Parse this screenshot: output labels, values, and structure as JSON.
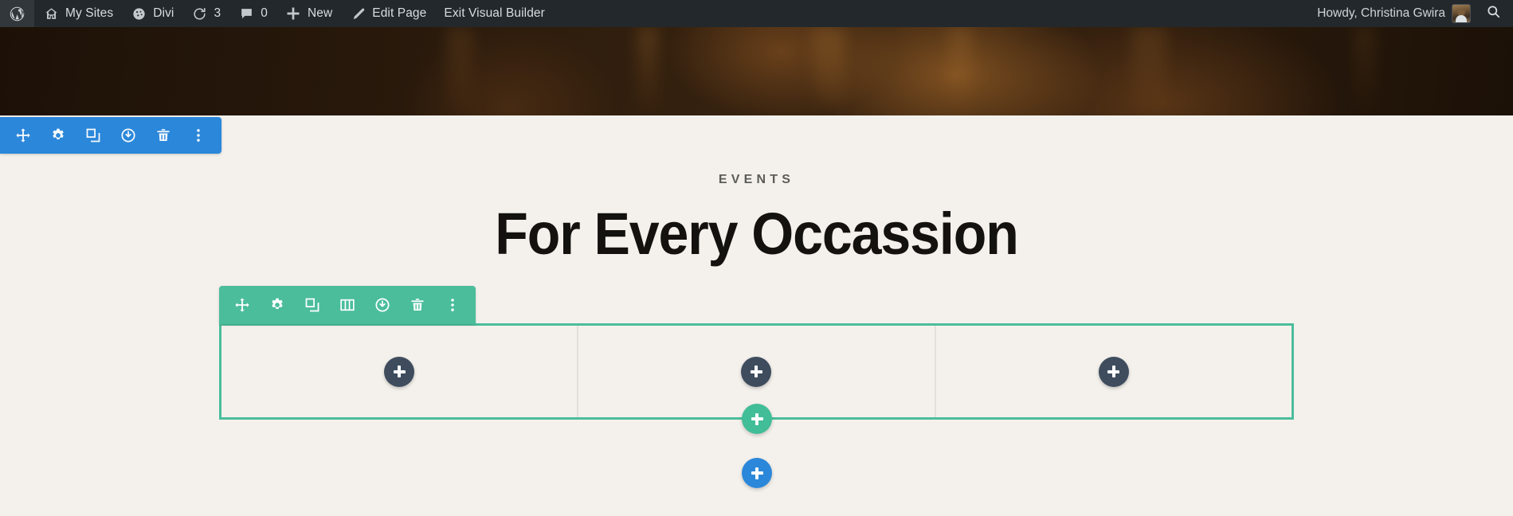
{
  "admin_bar": {
    "left_items": [
      {
        "icon": "wordpress-logo-icon",
        "label": ""
      },
      {
        "icon": "my-sites-icon",
        "label": "My Sites"
      },
      {
        "icon": "divi-icon",
        "label": "Divi"
      },
      {
        "icon": "updates-icon",
        "label": "3"
      },
      {
        "icon": "comments-icon",
        "label": "0"
      },
      {
        "icon": "new-content-icon",
        "label": "New"
      },
      {
        "icon": "edit-page-icon",
        "label": "Edit Page"
      },
      {
        "icon": "",
        "label": "Exit Visual Builder"
      }
    ],
    "howdy": "Howdy, Christina Gwira",
    "avatar_alt": "avatar",
    "search_icon": "search-icon",
    "background": "#23282d",
    "text_color": "#d8dde1"
  },
  "page": {
    "eyebrow": "EVENTS",
    "title": "For Every Occassion",
    "background": "#f4f1ec"
  },
  "section_toolbar": {
    "color": "#2b87da",
    "buttons": [
      {
        "name": "move-section-icon",
        "title": "Move Section"
      },
      {
        "name": "settings-gear-icon",
        "title": "Section Settings"
      },
      {
        "name": "duplicate-section-icon",
        "title": "Duplicate Section"
      },
      {
        "name": "disable-section-icon",
        "title": "Disable Section"
      },
      {
        "name": "delete-section-icon",
        "title": "Delete Section"
      },
      {
        "name": "section-options-icon",
        "title": "Other Options"
      }
    ]
  },
  "row_toolbar": {
    "color": "#4bbd9b",
    "buttons": [
      {
        "name": "move-row-icon",
        "title": "Move Row"
      },
      {
        "name": "settings-gear-icon",
        "title": "Row Settings"
      },
      {
        "name": "duplicate-row-icon",
        "title": "Duplicate Row"
      },
      {
        "name": "column-structure-icon",
        "title": "Change Column Structure"
      },
      {
        "name": "disable-row-icon",
        "title": "Disable Row"
      },
      {
        "name": "delete-row-icon",
        "title": "Delete Row"
      },
      {
        "name": "row-options-icon",
        "title": "Other Options"
      }
    ]
  },
  "row": {
    "border_color": "#4bbd9b",
    "column_divider_color": "#e3e0da",
    "columns": [
      {
        "name": "column-1",
        "add_module_label": "+"
      },
      {
        "name": "column-2",
        "add_module_label": "+"
      },
      {
        "name": "column-3",
        "add_module_label": "+"
      }
    ]
  },
  "add_buttons": {
    "add_row": {
      "label": "+",
      "color": "#41bd97"
    },
    "add_section": {
      "label": "+",
      "color": "#2b87da"
    },
    "add_module_color": "#3e4c5e"
  },
  "hero": {
    "alt": "dark brown hero background image"
  }
}
